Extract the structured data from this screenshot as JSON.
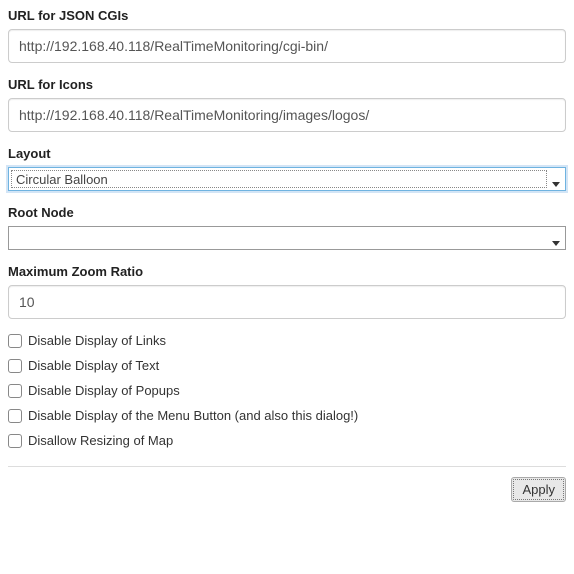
{
  "fields": {
    "json_cgis": {
      "label": "URL for JSON CGIs",
      "value": "http://192.168.40.118/RealTimeMonitoring/cgi-bin/"
    },
    "icons": {
      "label": "URL for Icons",
      "value": "http://192.168.40.118/RealTimeMonitoring/images/logos/"
    },
    "layout": {
      "label": "Layout",
      "value": "Circular Balloon"
    },
    "root_node": {
      "label": "Root Node",
      "value": ""
    },
    "zoom": {
      "label": "Maximum Zoom Ratio",
      "value": "10"
    }
  },
  "checkboxes": [
    {
      "label": "Disable Display of Links"
    },
    {
      "label": "Disable Display of Text"
    },
    {
      "label": "Disable Display of Popups"
    },
    {
      "label": "Disable Display of the Menu Button (and also this dialog!)"
    },
    {
      "label": "Disallow Resizing of Map"
    }
  ],
  "buttons": {
    "apply": "Apply"
  }
}
